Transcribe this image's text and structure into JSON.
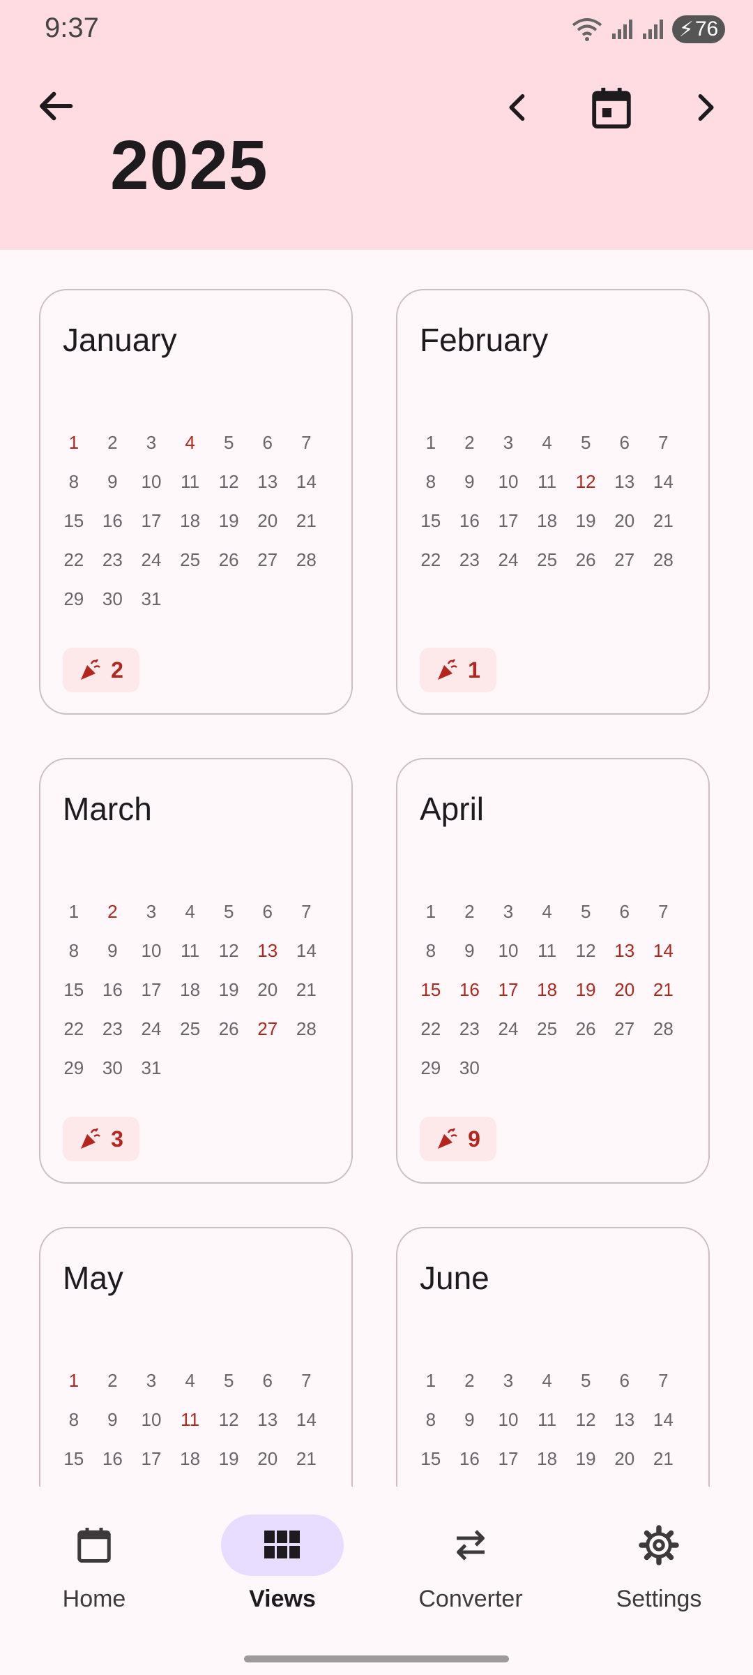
{
  "status": {
    "time": "9:37",
    "battery": "76"
  },
  "header": {
    "year": "2025"
  },
  "months": [
    {
      "name": "January",
      "offset": 0,
      "days": 31,
      "holidays": [
        1,
        4
      ],
      "holiday_count": "2"
    },
    {
      "name": "February",
      "offset": 0,
      "days": 28,
      "holidays": [
        12
      ],
      "holiday_count": "1"
    },
    {
      "name": "March",
      "offset": 0,
      "days": 31,
      "holidays": [
        2,
        13,
        27
      ],
      "holiday_count": "3"
    },
    {
      "name": "April",
      "offset": 0,
      "days": 30,
      "holidays": [
        13,
        14,
        15,
        16,
        17,
        18,
        19,
        20,
        21
      ],
      "holiday_count": "9"
    },
    {
      "name": "May",
      "offset": 0,
      "days": 21,
      "holidays": [
        1,
        11
      ],
      "holiday_count": ""
    },
    {
      "name": "June",
      "offset": 0,
      "days": 21,
      "holidays": [],
      "holiday_count": ""
    }
  ],
  "bottom_nav": [
    {
      "label": "Home",
      "icon": "calendar-icon",
      "active": false
    },
    {
      "label": "Views",
      "icon": "grid-view-icon",
      "active": true
    },
    {
      "label": "Converter",
      "icon": "swap-icon",
      "active": false
    },
    {
      "label": "Settings",
      "icon": "gear-icon",
      "active": false
    }
  ],
  "colors": {
    "header_bg": "#ffdbe2",
    "holiday": "#b3261e",
    "active_pill": "#e8ddff"
  }
}
